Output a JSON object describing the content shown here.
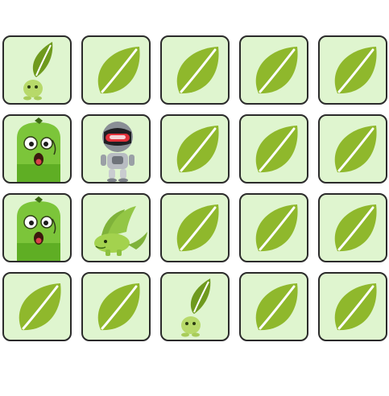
{
  "board": {
    "rows": 4,
    "columns": 5,
    "cards": [
      {
        "row": 1,
        "col": 1,
        "state": "face-up",
        "face": "sprout-creature"
      },
      {
        "row": 1,
        "col": 2,
        "state": "face-down",
        "face": "leaf-back"
      },
      {
        "row": 1,
        "col": 3,
        "state": "face-down",
        "face": "leaf-back"
      },
      {
        "row": 1,
        "col": 4,
        "state": "face-down",
        "face": "leaf-back"
      },
      {
        "row": 1,
        "col": 5,
        "state": "face-down",
        "face": "leaf-back"
      },
      {
        "row": 2,
        "col": 1,
        "state": "face-up",
        "face": "green-monster"
      },
      {
        "row": 2,
        "col": 2,
        "state": "face-up",
        "face": "ninja-robot"
      },
      {
        "row": 2,
        "col": 3,
        "state": "face-down",
        "face": "leaf-back"
      },
      {
        "row": 2,
        "col": 4,
        "state": "face-down",
        "face": "leaf-back"
      },
      {
        "row": 2,
        "col": 5,
        "state": "face-down",
        "face": "leaf-back"
      },
      {
        "row": 3,
        "col": 1,
        "state": "face-up",
        "face": "green-monster"
      },
      {
        "row": 3,
        "col": 2,
        "state": "face-up",
        "face": "leaf-dragon"
      },
      {
        "row": 3,
        "col": 3,
        "state": "face-down",
        "face": "leaf-back"
      },
      {
        "row": 3,
        "col": 4,
        "state": "face-down",
        "face": "leaf-back"
      },
      {
        "row": 3,
        "col": 5,
        "state": "face-down",
        "face": "leaf-back"
      },
      {
        "row": 4,
        "col": 1,
        "state": "face-down",
        "face": "leaf-back"
      },
      {
        "row": 4,
        "col": 2,
        "state": "face-down",
        "face": "leaf-back"
      },
      {
        "row": 4,
        "col": 3,
        "state": "face-up",
        "face": "sprout-creature"
      },
      {
        "row": 4,
        "col": 4,
        "state": "face-down",
        "face": "leaf-back"
      },
      {
        "row": 4,
        "col": 5,
        "state": "face-down",
        "face": "leaf-back"
      }
    ]
  },
  "colors": {
    "card_background": "#dff5cf",
    "card_border": "#2b2b2b",
    "leaf": "#8fb82c",
    "leaf_vein": "#ffffff",
    "monster_green": "#7cc53a",
    "robot_gray": "#8a8f96",
    "robot_visor": "#e0313a"
  }
}
